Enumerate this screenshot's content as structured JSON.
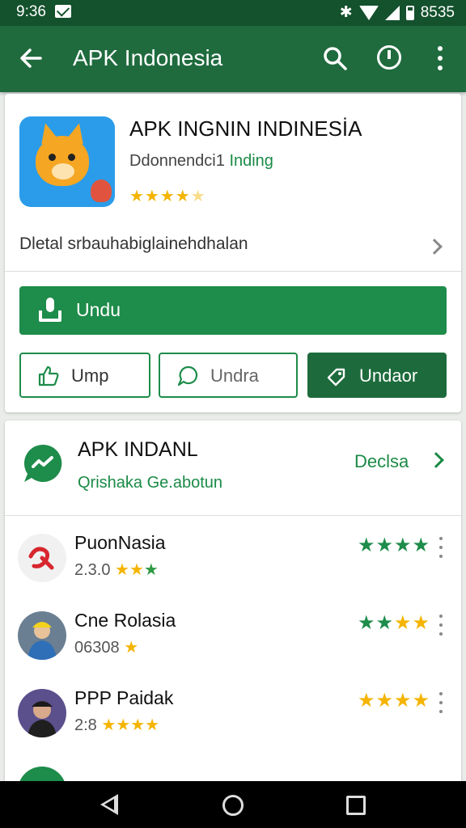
{
  "status_bar": {
    "time": "9:36",
    "right_text": "8535",
    "icons": [
      "mail-icon",
      "bluetooth-icon",
      "wifi-icon",
      "signal-icon",
      "battery-icon"
    ]
  },
  "app_bar": {
    "title": "APK Indonesia",
    "icons": [
      "back-arrow-icon",
      "search-icon",
      "info-icon",
      "more-vert-icon"
    ]
  },
  "app": {
    "title": "APK INGNIN INDINESİA",
    "developer": "Ddonnendci1",
    "developer_highlight": "Inding",
    "stars": "★★★★",
    "stars_dim": "★",
    "rating": 4.5
  },
  "detail": {
    "label": "Dletal srbauhabiglainehdhalan"
  },
  "install_button": {
    "label": "Undu"
  },
  "buttons": [
    {
      "label": "Ump"
    },
    {
      "label": "Undra"
    },
    {
      "label": "Undaor"
    }
  ],
  "section": {
    "title": "APK INDANL",
    "subtitle": "Qrishaka Ge.abotun",
    "more_label": "Declsa"
  },
  "list": [
    {
      "name": "PuonNasia",
      "sub": "2.3.0",
      "sub_stars": "★★",
      "sub_stars_green": "★",
      "stars": "★★★★",
      "stars_color": "#1e8c4a"
    },
    {
      "name": "Cne Rolasia",
      "sub": "06308",
      "sub_stars": "★",
      "sub_stars_green": "",
      "stars": "★★★★",
      "stars_color": "#f4b400"
    },
    {
      "name": "PPP Paidak",
      "sub": "2:8",
      "sub_stars": "★★★★",
      "sub_stars_green": "",
      "stars": "★★★★",
      "stars_color": "#f4b400"
    }
  ],
  "colors": {
    "primary": "#1f6b3e",
    "accent": "#1e8c4a",
    "star": "#f4b400"
  }
}
